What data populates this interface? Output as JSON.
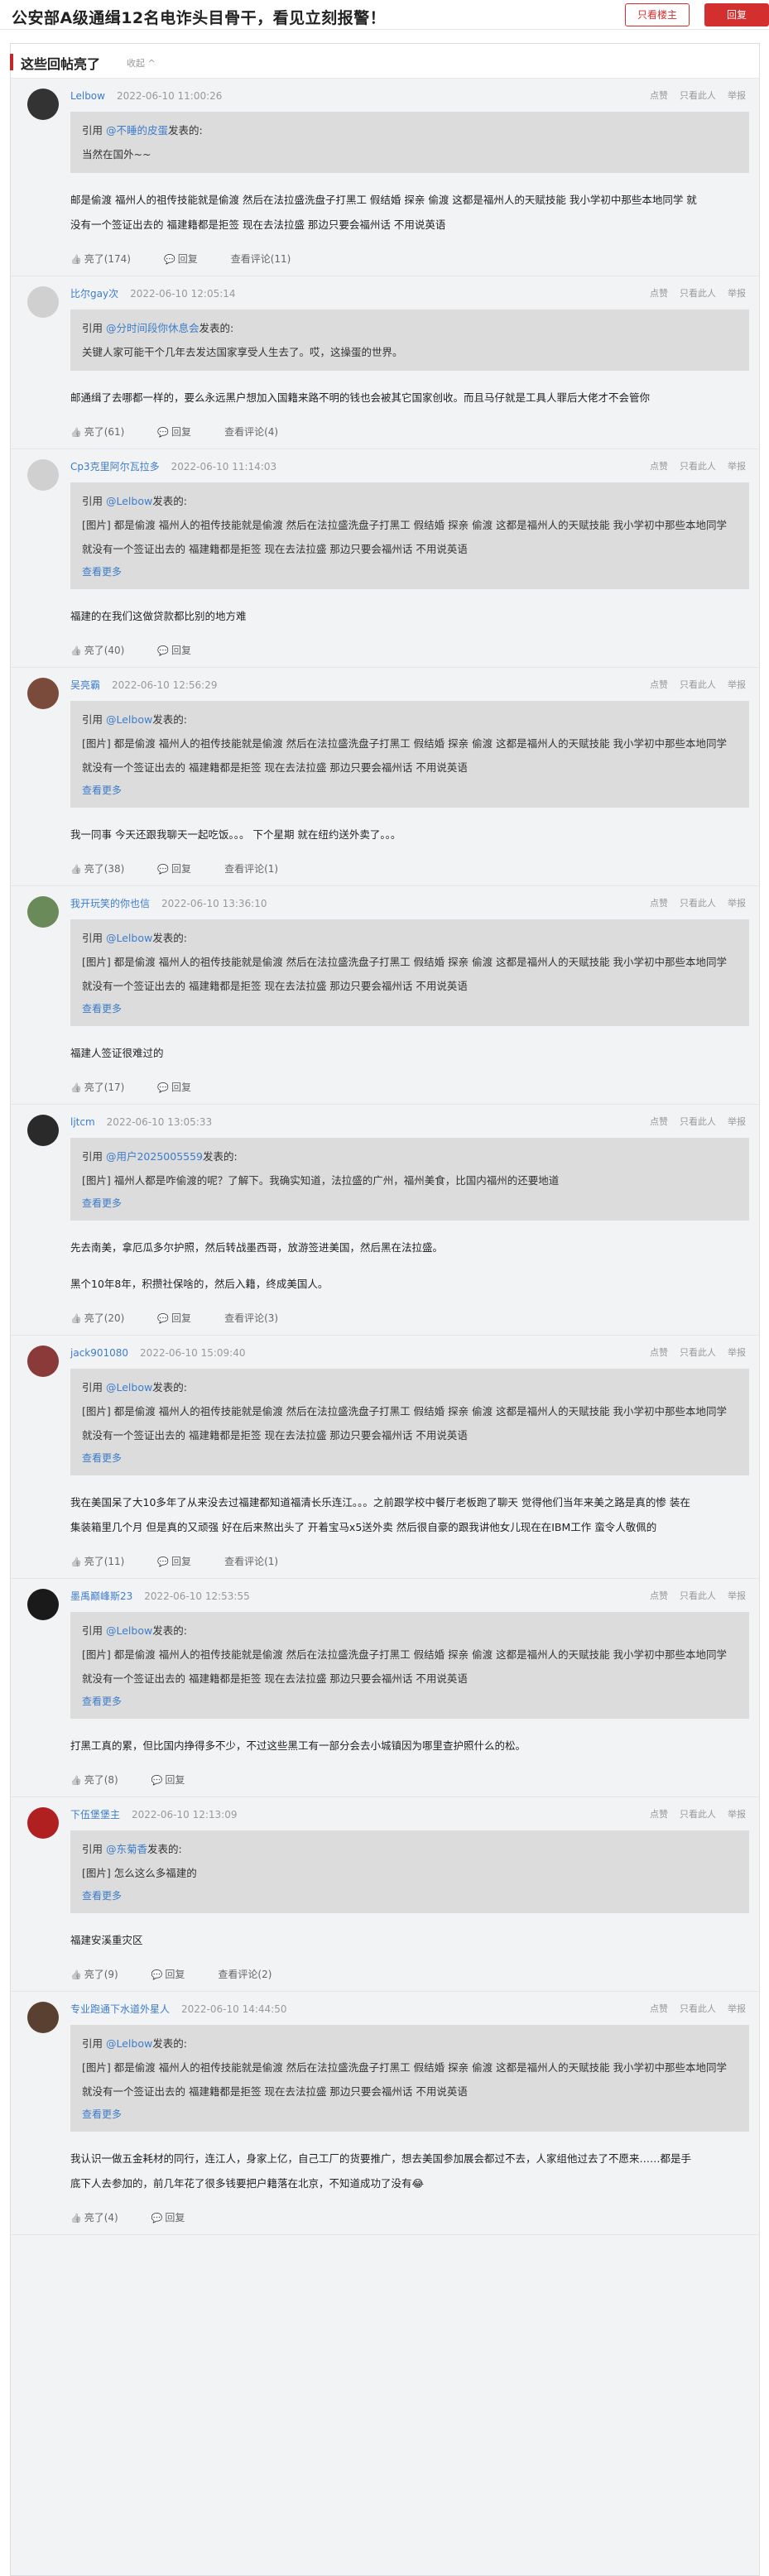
{
  "header": {
    "title": "公安部A级通缉12名电诈头目骨干，看见立刻报警！",
    "only_op_label": "只看楼主",
    "reply_label": "回复"
  },
  "section": {
    "title": "这些回帖亮了",
    "collapse_label": "收起 ^"
  },
  "ops": [
    "点赞",
    "只看此人",
    "举报"
  ],
  "actions": {
    "reply": "回复",
    "view_comments_prefix": "查看评论"
  },
  "quote": {
    "prefix": "引用",
    "suffix": "发表的:",
    "more": "查看更多"
  },
  "posts": [
    {
      "name": "Lelbow",
      "time": "2022-06-10 11:00:26",
      "avatar_color": "#333333",
      "quote_user": "@不睡的皮蛋",
      "quote_lines": [
        "当然在国外~~"
      ],
      "quote_more": false,
      "body": [
        "邮是偷渡 福州人的祖传技能就是偷渡 然后在法拉盛洗盘子打黑工 假结婚 探亲 偷渡 这都是福州人的天赋技能 我小学初中那些本地同学 就没有一个签证出去的 福建籍都是拒签 现在去法拉盛 那边只要会福州话 不用说英语"
      ],
      "likes": "亮了(174)",
      "comments": "(11)"
    },
    {
      "name": "比尔gay次",
      "time": "2022-06-10 12:05:14",
      "avatar_color": "#d0d0d0",
      "quote_user": "@分时间段你休息会",
      "quote_lines": [
        "关键人家可能干个几年去发达国家享受人生去了。哎，这操蛋的世界。"
      ],
      "quote_more": false,
      "body": [
        "邮通缉了去哪都一样的，要么永远黑户想加入国籍来路不明的钱也会被其它国家创收。而且马仔就是工具人罪后大佬才不会管你"
      ],
      "likes": "亮了(61)",
      "comments": "(4)"
    },
    {
      "name": "Cp3克里阿尔瓦拉多",
      "time": "2022-06-10 11:14:03",
      "avatar_color": "#d0d0d0",
      "quote_user": "@Lelbow",
      "quote_lines": [
        "[图片] 都是偷渡 福州人的祖传技能就是偷渡 然后在法拉盛洗盘子打黑工 假结婚 探亲 偷渡 这都是福州人的天赋技能 我小学初中那些本地同学 就没有一个签证出去的 福建籍都是拒签 现在去法拉盛 那边只要会福州话 不用说英语"
      ],
      "quote_more": true,
      "body": [
        "福建的在我们这做贷款都比别的地方难"
      ],
      "likes": "亮了(40)",
      "comments": null
    },
    {
      "name": "吴亮霸",
      "time": "2022-06-10 12:56:29",
      "avatar_color": "#7a4b3a",
      "quote_user": "@Lelbow",
      "quote_lines": [
        "[图片] 都是偷渡 福州人的祖传技能就是偷渡 然后在法拉盛洗盘子打黑工 假结婚 探亲 偷渡 这都是福州人的天赋技能 我小学初中那些本地同学 就没有一个签证出去的 福建籍都是拒签 现在去法拉盛 那边只要会福州话 不用说英语"
      ],
      "quote_more": true,
      "body": [
        "我一同事 今天还跟我聊天一起吃饭。。。 下个星期 就在纽约送外卖了。。。"
      ],
      "likes": "亮了(38)",
      "comments": "(1)"
    },
    {
      "name": "我开玩笑的你也信",
      "time": "2022-06-10 13:36:10",
      "avatar_color": "#6a8a5a",
      "quote_user": "@Lelbow",
      "quote_lines": [
        "[图片] 都是偷渡 福州人的祖传技能就是偷渡 然后在法拉盛洗盘子打黑工 假结婚 探亲 偷渡 这都是福州人的天赋技能 我小学初中那些本地同学 就没有一个签证出去的 福建籍都是拒签 现在去法拉盛 那边只要会福州话 不用说英语"
      ],
      "quote_more": true,
      "body": [
        "福建人签证很难过的"
      ],
      "likes": "亮了(17)",
      "comments": null
    },
    {
      "name": "ljtcm",
      "time": "2022-06-10 13:05:33",
      "avatar_color": "#2a2a2a",
      "quote_user": "@用户2025005559",
      "quote_lines": [
        "[图片] 福州人都是咋偷渡的呢？了解下。我确实知道，法拉盛的广州，福州美食，比国内福州的还要地道"
      ],
      "quote_more": true,
      "body": [
        "先去南美，拿厄瓜多尔护照，然后转战墨西哥，放游签进美国，然后黑在法拉盛。",
        "黑个10年8年，积攒社保啥的，然后入籍，终成美国人。"
      ],
      "likes": "亮了(20)",
      "comments": "(3)"
    },
    {
      "name": "jack901080",
      "time": "2022-06-10 15:09:40",
      "avatar_color": "#8b3a3a",
      "quote_user": "@Lelbow",
      "quote_lines": [
        "[图片] 都是偷渡 福州人的祖传技能就是偷渡 然后在法拉盛洗盘子打黑工 假结婚 探亲 偷渡 这都是福州人的天赋技能 我小学初中那些本地同学 就没有一个签证出去的 福建籍都是拒签 现在去法拉盛 那边只要会福州话 不用说英语"
      ],
      "quote_more": true,
      "body": [
        "我在美国呆了大10多年了从来没去过福建都知道福清长乐连江。。。之前跟学校中餐厅老板跑了聊天 觉得他们当年来美之路是真的惨 装在集装箱里几个月 但是真的又顽强 好在后来熬出头了 开着宝马x5送外卖 然后很自豪的跟我讲他女儿现在在IBM工作 蛮令人敬佩的"
      ],
      "likes": "亮了(11)",
      "comments": "(1)"
    },
    {
      "name": "墨禹巅峰斯23",
      "time": "2022-06-10 12:53:55",
      "avatar_color": "#1a1a1a",
      "quote_user": "@Lelbow",
      "quote_lines": [
        "[图片] 都是偷渡 福州人的祖传技能就是偷渡 然后在法拉盛洗盘子打黑工 假结婚 探亲 偷渡 这都是福州人的天赋技能 我小学初中那些本地同学 就没有一个签证出去的 福建籍都是拒签 现在去法拉盛 那边只要会福州话 不用说英语"
      ],
      "quote_more": true,
      "body": [
        "打黑工真的累，但比国内挣得多不少，不过这些黑工有一部分会去小城镇因为哪里查护照什么的松。"
      ],
      "likes": "亮了(8)",
      "comments": null
    },
    {
      "name": "下伍堡堡主",
      "time": "2022-06-10 12:13:09",
      "avatar_color": "#b02020",
      "quote_user": "@东菊香",
      "quote_lines": [
        "[图片] 怎么这么多福建的"
      ],
      "quote_more": true,
      "body": [
        "福建安溪重灾区"
      ],
      "likes": "亮了(9)",
      "comments": "(2)"
    },
    {
      "name": "专业跑通下水道外星人",
      "time": "2022-06-10 14:44:50",
      "avatar_color": "#5a4030",
      "quote_user": "@Lelbow",
      "quote_lines": [
        "[图片] 都是偷渡 福州人的祖传技能就是偷渡 然后在法拉盛洗盘子打黑工 假结婚 探亲 偷渡 这都是福州人的天赋技能 我小学初中那些本地同学 就没有一个签证出去的 福建籍都是拒签 现在去法拉盛 那边只要会福州话 不用说英语"
      ],
      "quote_more": true,
      "body": [
        "我认识一做五金耗材的同行，连江人，身家上亿，自己工厂的货要推广，想去美国参加展会都过不去，人家组他过去了不愿来……都是手底下人去参加的，前几年花了很多钱要把户籍落在北京，不知道成功了没有😂"
      ],
      "likes": "亮了(4)",
      "comments": null
    }
  ]
}
